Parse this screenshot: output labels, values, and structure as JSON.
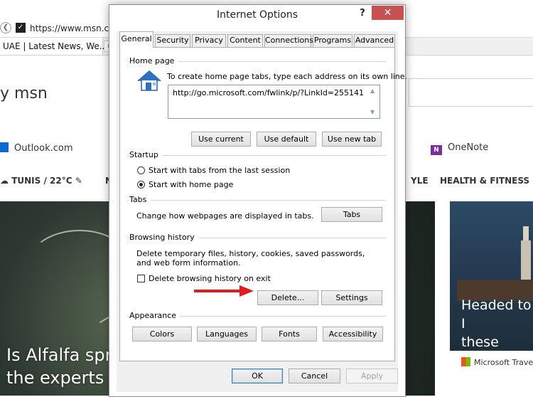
{
  "browser": {
    "address": "https://www.msn.co",
    "tab_title": "UAE | Latest News, We...",
    "logo": "msn",
    "shortcuts": [
      {
        "label": "Outlook.com"
      },
      {
        "label": "OneNote"
      }
    ],
    "weather": "TUNIS / 22°C",
    "menu_partial_left": "N",
    "menu_partial_mid": "YLE",
    "menu_health": "HEALTH & FITNESS",
    "hero_title": "Is Alfalfa spr\nthe experts",
    "card_title": "Headed to I\nthese unfor\nattractions",
    "card_source": "Microsoft Travel"
  },
  "dialog": {
    "title": "Internet Options",
    "help": "?",
    "close": "✕",
    "tabs": [
      "General",
      "Security",
      "Privacy",
      "Content",
      "Connections",
      "Programs",
      "Advanced"
    ],
    "active_tab": "General",
    "home_page": {
      "label": "Home page",
      "description": "To create home page tabs, type each address on its own line.",
      "url": "http://go.microsoft.com/fwlink/p/?LinkId=255141",
      "use_current": "Use current",
      "use_default": "Use default",
      "use_new_tab": "Use new tab"
    },
    "startup": {
      "label": "Startup",
      "option1": "Start with tabs from the last session",
      "option2": "Start with home page",
      "selected": "Start with home page"
    },
    "tabs_section": {
      "label": "Tabs",
      "description": "Change how webpages are displayed in tabs.",
      "button": "Tabs"
    },
    "browsing_history": {
      "label": "Browsing history",
      "description": "Delete temporary files, history, cookies, saved passwords, and web form information.",
      "checkbox": "Delete browsing history on exit",
      "checked": false,
      "delete": "Delete...",
      "settings": "Settings"
    },
    "appearance": {
      "label": "Appearance",
      "colors": "Colors",
      "languages": "Languages",
      "fonts": "Fonts",
      "accessibility": "Accessibility"
    },
    "footer": {
      "ok": "OK",
      "cancel": "Cancel",
      "apply": "Apply"
    }
  },
  "colors": {
    "close_button": "#c75050",
    "arrow": "#e01b1b",
    "outlook": "#0a6ad1",
    "onenote": "#7a2d9b"
  }
}
